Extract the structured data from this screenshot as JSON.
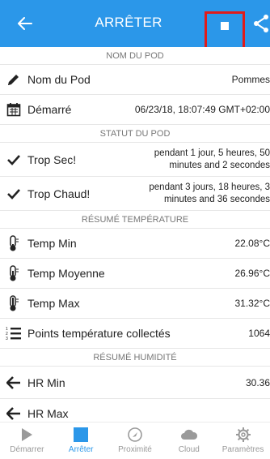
{
  "app_bar": {
    "title": "ARRÊTER",
    "back_icon": "arrow-left-icon",
    "stop_icon": "stop-icon",
    "share_icon": "share-icon",
    "background_color": "#2b97e9",
    "highlight_color": "#e01b1b"
  },
  "sections": {
    "pod_name_header": "NOM DU POD",
    "pod_status_header": "STATUT DU POD",
    "temp_summary_header": "RÉSUMÉ TEMPÉRATURE",
    "humidity_summary_header": "RÉSUMÉ HUMIDITÉ"
  },
  "rows": {
    "pod_name": {
      "label": "Nom du Pod",
      "value": "Pommes",
      "icon": "pencil-icon"
    },
    "started": {
      "label": "Démarré",
      "value": "06/23/18, 18:07:49 GMT+02:00",
      "icon": "calendar-icon"
    },
    "too_dry": {
      "label": "Trop Sec!",
      "value_line1": "pendant 1 jour, 5 heures, 50",
      "value_line2": "minutes and 2 secondes",
      "icon": "checkmark-icon"
    },
    "too_hot": {
      "label": "Trop Chaud!",
      "value_line1": "pendant 3 jours, 18 heures, 3",
      "value_line2": "minutes and 36 secondes",
      "icon": "checkmark-icon"
    },
    "temp_min": {
      "label": "Temp Min",
      "value": "22.08°C",
      "icon": "thermometer-low-icon"
    },
    "temp_avg": {
      "label": "Temp Moyenne",
      "value": "26.96°C",
      "icon": "thermometer-half-icon"
    },
    "temp_max": {
      "label": "Temp Max",
      "value": "31.32°C",
      "icon": "thermometer-full-icon"
    },
    "temp_points": {
      "label": "Points température collectés",
      "value": "1064",
      "icon": "numbered-list-icon"
    },
    "hr_min": {
      "label": "HR Min",
      "value": "30.36",
      "icon": "arrow-left-icon"
    },
    "hr_max": {
      "label": "HR Max",
      "value": "",
      "icon": "arrow-icon"
    }
  },
  "bottom_nav": {
    "items": [
      {
        "label": "Démarrer",
        "icon": "play-icon",
        "active": false
      },
      {
        "label": "Arrêter",
        "icon": "stop-icon",
        "active": true
      },
      {
        "label": "Proximité",
        "icon": "proximity-icon",
        "active": false
      },
      {
        "label": "Cloud",
        "icon": "cloud-icon",
        "active": false
      },
      {
        "label": "Paramètres",
        "icon": "gear-icon",
        "active": false
      }
    ],
    "active_color": "#2b97e9",
    "inactive_color": "#999999"
  }
}
